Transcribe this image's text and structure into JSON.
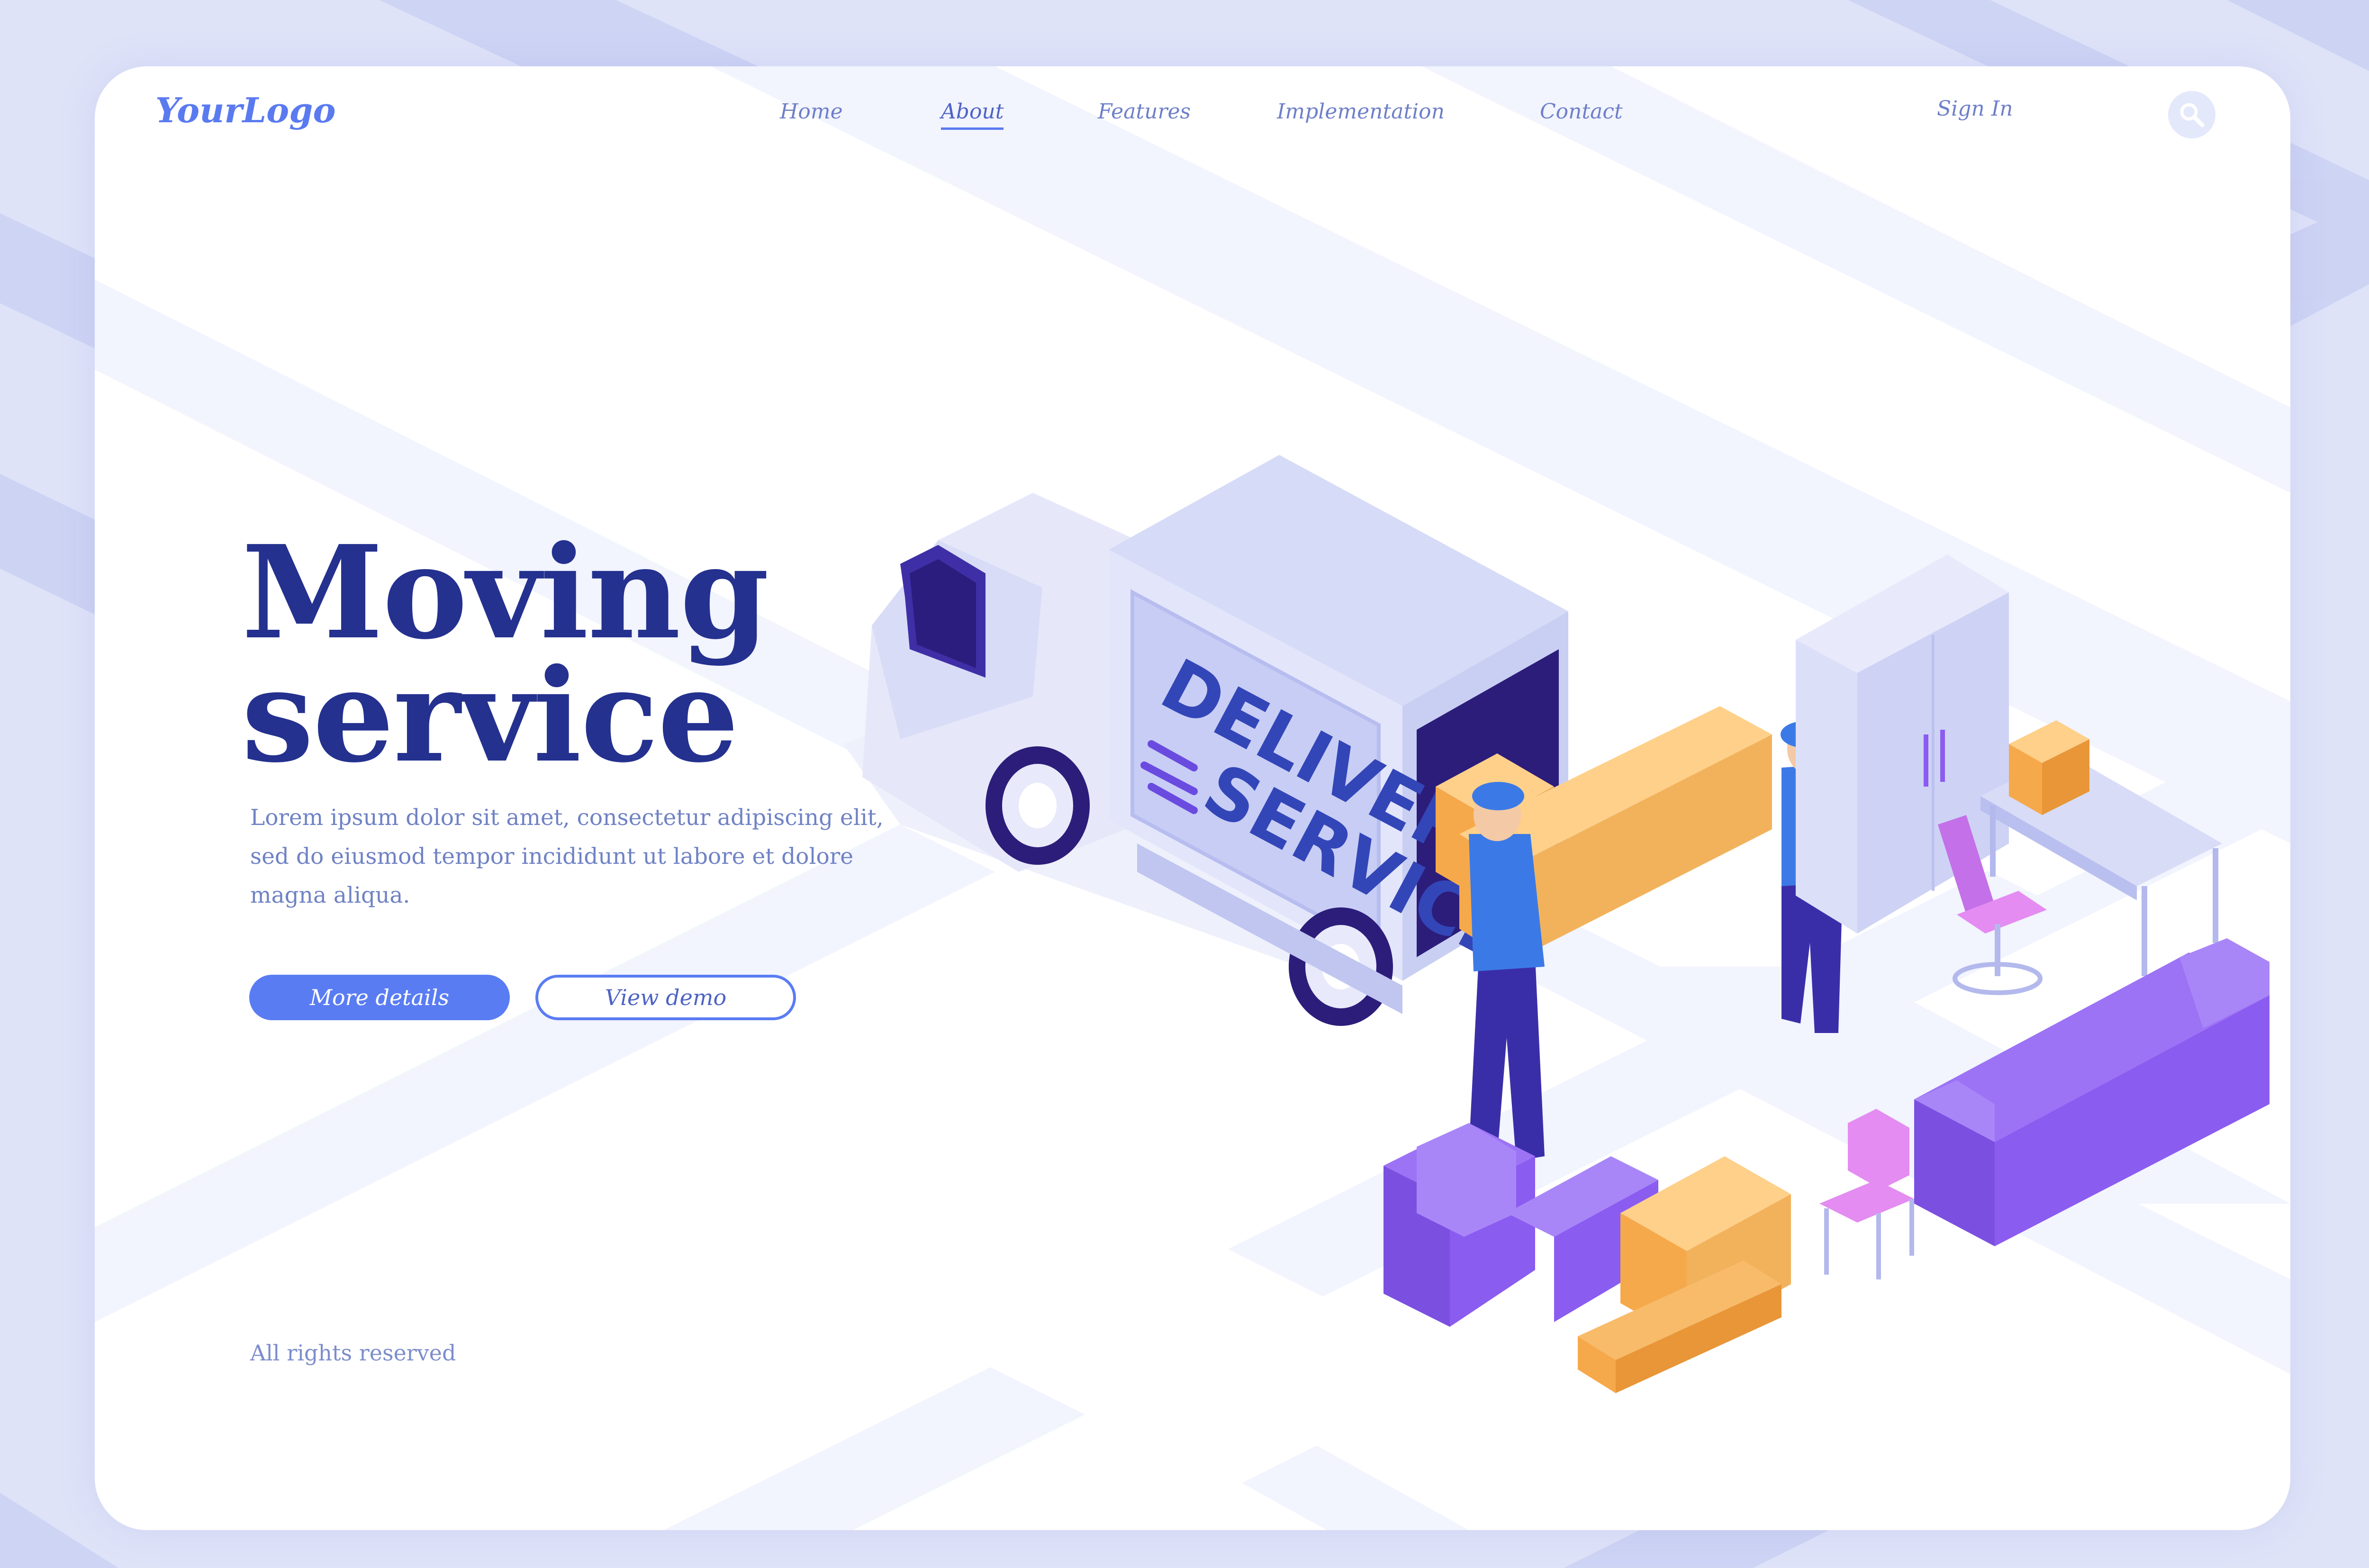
{
  "header": {
    "logo": "YourLogo",
    "nav": [
      {
        "label": "Home",
        "active": false
      },
      {
        "label": "About",
        "active": true
      },
      {
        "label": "Features",
        "active": false
      },
      {
        "label": "Implementation",
        "active": false
      },
      {
        "label": "Contact",
        "active": false
      }
    ],
    "sign_in": "Sign In",
    "search_icon": "search-icon"
  },
  "hero": {
    "title_line1": "Moving",
    "title_line2": "service",
    "description": "Lorem ipsum dolor sit amet, consectetur adipiscing elit, sed do eiusmod tempor incididunt ut labore et dolore magna aliqua.",
    "primary_button": "More details",
    "secondary_button": "View demo"
  },
  "illustration": {
    "truck_text_line1": "DELIVERY",
    "truck_text_line2": "SERVICE"
  },
  "footer": {
    "copyright": "All rights reserved"
  },
  "colors": {
    "background": "#dfe3f8",
    "card": "#ffffff",
    "accent": "#5a7cf3",
    "heading": "#24318f",
    "text": "#6f82c4",
    "furniture_purple": "#8b5cf0",
    "box_orange": "#f5b25e",
    "worker_blue": "#3b7ae6"
  }
}
